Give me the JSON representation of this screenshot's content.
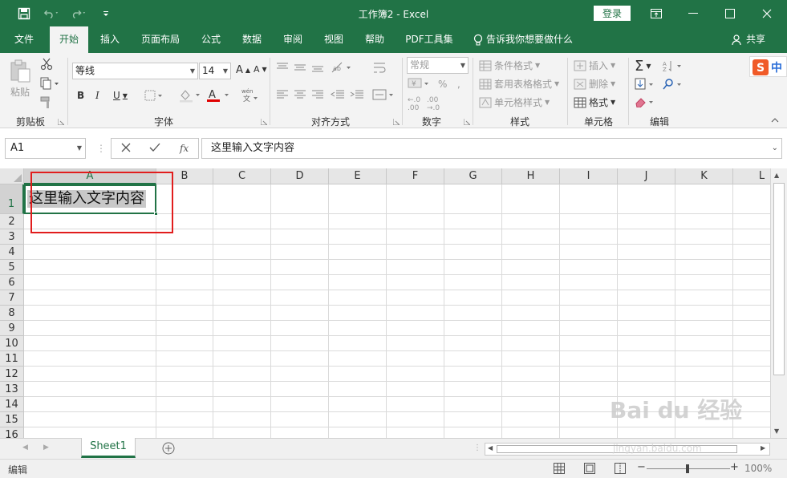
{
  "window": {
    "title": "工作簿2  -  Excel",
    "login_label": "登录"
  },
  "tabs": [
    {
      "label": "文件"
    },
    {
      "label": "开始"
    },
    {
      "label": "插入"
    },
    {
      "label": "页面布局"
    },
    {
      "label": "公式"
    },
    {
      "label": "数据"
    },
    {
      "label": "审阅"
    },
    {
      "label": "视图"
    },
    {
      "label": "帮助"
    },
    {
      "label": "PDF工具集"
    }
  ],
  "tell_me": "告诉我你想要做什么",
  "share": "共享",
  "ribbon": {
    "clipboard": {
      "paste": "粘贴",
      "label": "剪贴板"
    },
    "font": {
      "name": "等线",
      "size": "14",
      "label": "字体"
    },
    "alignment": {
      "label": "对齐方式"
    },
    "number": {
      "format": "常规",
      "label": "数字"
    },
    "styles": {
      "conditional": "条件格式",
      "table": "套用表格格式",
      "cell_styles": "单元格样式",
      "label": "样式"
    },
    "cells": {
      "insert": "插入",
      "delete": "删除",
      "format": "格式",
      "label": "单元格"
    },
    "editing": {
      "label": "编辑"
    },
    "ime": "中"
  },
  "formula_bar": {
    "name_box": "A1",
    "fx": "fx",
    "content": "这里输入文字内容"
  },
  "grid": {
    "columns": [
      "A",
      "B",
      "C",
      "D",
      "E",
      "F",
      "G",
      "H",
      "I",
      "J",
      "K",
      "L"
    ],
    "rows": [
      "1",
      "2",
      "3",
      "4",
      "5",
      "6",
      "7",
      "8",
      "9",
      "10",
      "11",
      "12",
      "13",
      "14",
      "15",
      "16"
    ],
    "cell_A1": "这里输入文字内容"
  },
  "sheet": {
    "tab": "Sheet1"
  },
  "status": {
    "mode": "编辑",
    "zoom": "100%"
  },
  "watermark": {
    "text": "Bai du 经验",
    "url": "jingyan.baidu.com"
  },
  "colors": {
    "accent": "#217346",
    "highlight_box": "#e11d1d"
  }
}
